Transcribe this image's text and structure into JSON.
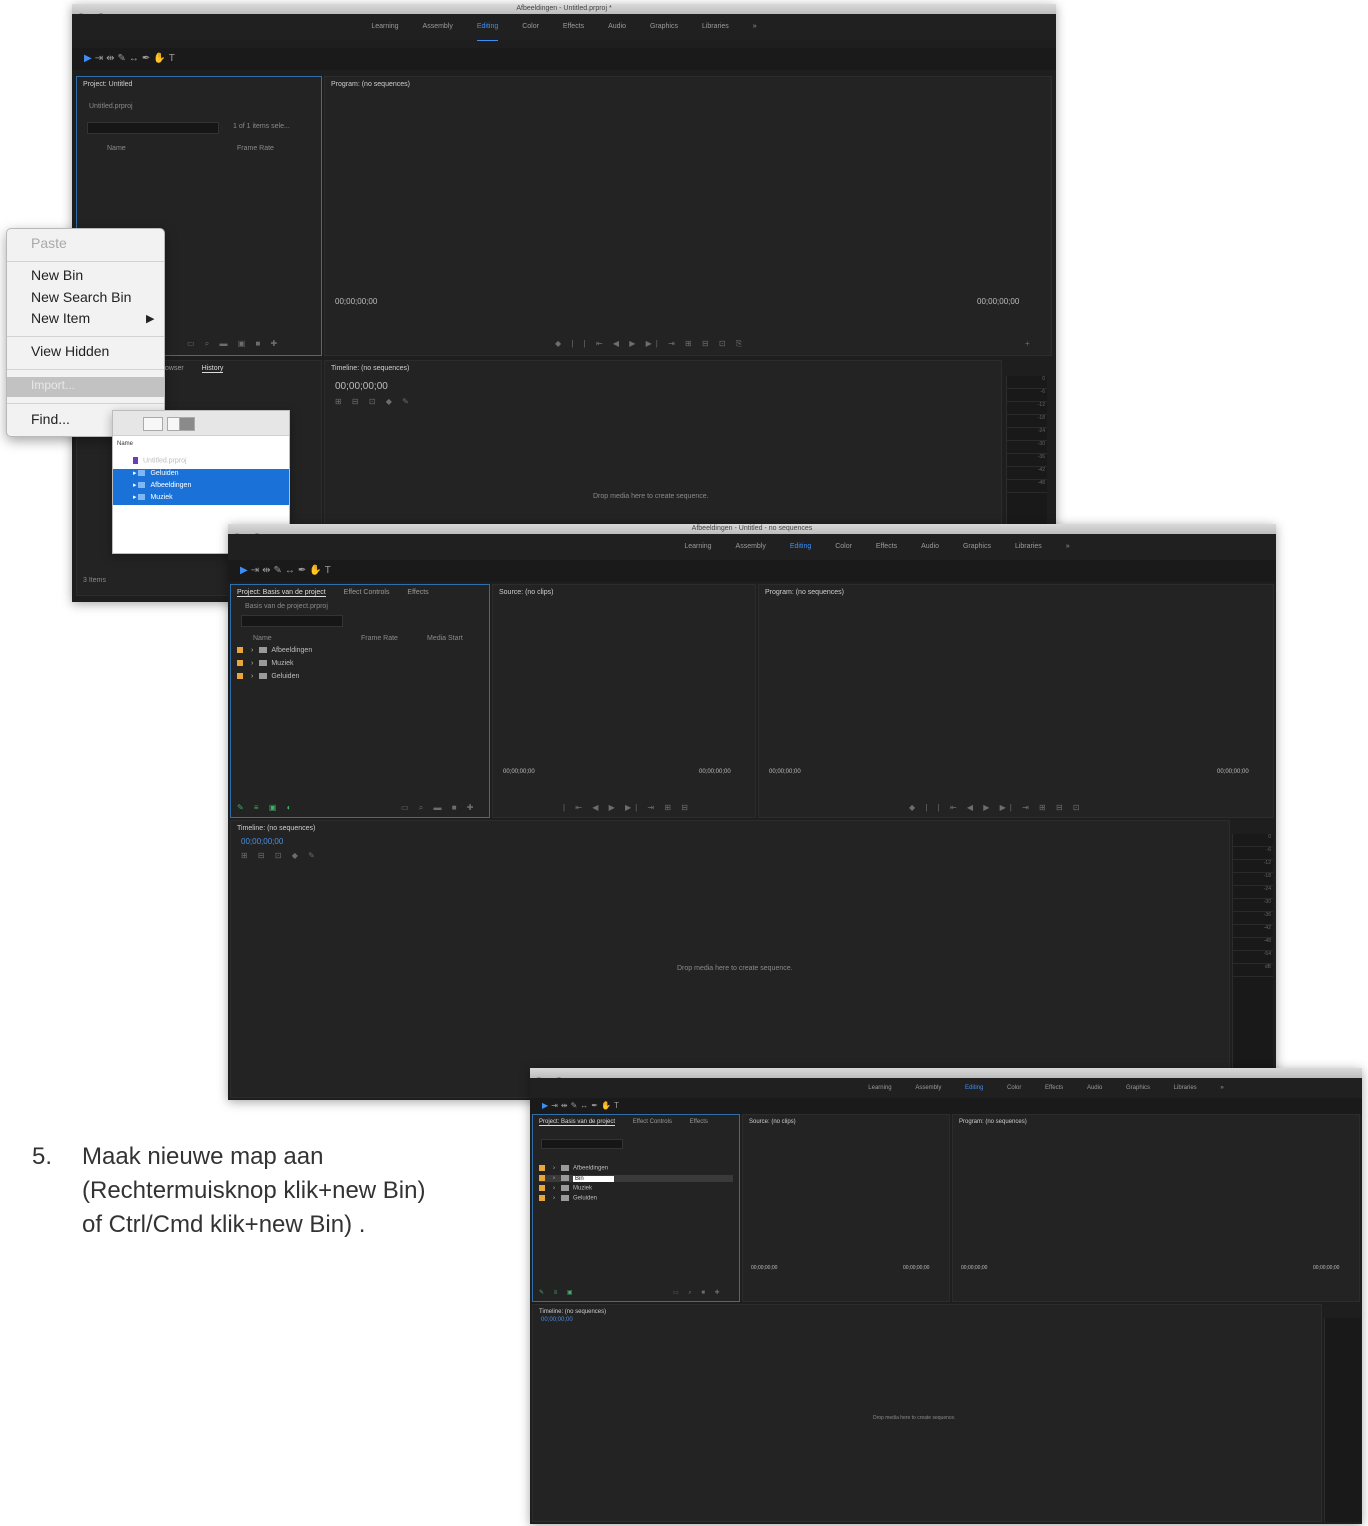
{
  "window1": {
    "title": "Afbeeldingen - Untitled.prproj *",
    "workspaces": [
      "Learning",
      "Assembly",
      "Editing",
      "Color",
      "Effects",
      "Audio",
      "Graphics",
      "Libraries",
      "»"
    ],
    "active_workspace": "Editing",
    "project_panel": {
      "title": "Project: Untitled",
      "project_name": "Untitled.prproj",
      "items_count": "1 of 1 items sele...",
      "col_name": "Name",
      "col_framerate": "Frame Rate"
    },
    "program_panel": {
      "title": "Program: (no sequences)",
      "tc_left": "00;00;00;00",
      "tc_right": "00;00;00;00"
    },
    "timeline_panel": {
      "title": "Timeline: (no sequences)",
      "timecode": "00;00;00;00",
      "drop_text": "Drop media here to create sequence."
    },
    "lower_tabs": [
      "Media Browser",
      "History"
    ],
    "status": "3 Items"
  },
  "context_menu": {
    "items": [
      "Paste",
      "New Bin",
      "New Search Bin",
      "New Item",
      "View Hidden",
      "Import...",
      "Find..."
    ],
    "disabled": [
      "Paste",
      "Import..."
    ],
    "highlighted": "Import...",
    "submenu_arrow": "▶"
  },
  "finder": {
    "header": "Name",
    "rows": [
      {
        "label": "Untitled.prproj",
        "selected": false
      },
      {
        "label": "Geluiden",
        "selected": true
      },
      {
        "label": "Afbeeldingen",
        "selected": true
      },
      {
        "label": "Muziek",
        "selected": true
      }
    ]
  },
  "window2": {
    "title": "Afbeeldingen - Untitled - no sequences",
    "workspaces": [
      "Learning",
      "Assembly",
      "Editing",
      "Color",
      "Effects",
      "Audio",
      "Graphics",
      "Libraries",
      "»"
    ],
    "active_workspace": "Editing",
    "project_tabs": [
      "Project: Basis van de project",
      "Effect Controls",
      "Effects"
    ],
    "search_label": "Basis van de project.prproj",
    "col_name": "Name",
    "col_framerate": "Frame Rate",
    "col_media_start": "Media Start",
    "bins": [
      "Afbeeldingen",
      "Muziek",
      "Geluiden"
    ],
    "source_panel": {
      "title": "Source: (no clips)",
      "tc_left": "00;00;00;00",
      "tc_right": "00;00;00;00"
    },
    "program_panel": {
      "title": "Program: (no sequences)",
      "tc_left": "00;00;00;00",
      "tc_right": "00;00;00;00"
    },
    "timeline_panel": {
      "title": "Timeline: (no sequences)",
      "timecode": "00;00;00;00",
      "drop_text": "Drop media here to create sequence."
    }
  },
  "window3": {
    "workspaces": [
      "Learning",
      "Assembly",
      "Editing",
      "Color",
      "Effects",
      "Audio",
      "Graphics",
      "Libraries",
      "»"
    ],
    "active_workspace": "Editing",
    "project_tabs": [
      "Project: Basis van de project",
      "Effect Controls",
      "Effects"
    ],
    "bins": [
      "Afbeeldingen",
      "Bin",
      "Muziek",
      "Geluiden"
    ],
    "editing_bin": "Bin",
    "source_panel": {
      "title": "Source: (no clips)",
      "tc_left": "00;00;00;00",
      "tc_right": "00;00;00;00"
    },
    "program_panel": {
      "title": "Program: (no sequences)",
      "tc_left": "00;00;00;00",
      "tc_right": "00;00;00;00"
    },
    "timeline_panel": {
      "title": "Timeline: (no sequences)",
      "timecode": "00;00;00;00",
      "drop_text": "Drop media here to create sequence."
    }
  },
  "caption": {
    "number": "5.",
    "line1": "Maak nieuwe map aan",
    "line2": "(Rechtermuisknop klik+new Bin)",
    "line3": " of Ctrl/Cmd klik+new Bin) ."
  },
  "meter_labels": [
    "0",
    "-6",
    "-12",
    "-18",
    "-24",
    "-30",
    "-36",
    "-42",
    "-48",
    "-54",
    "dB"
  ]
}
